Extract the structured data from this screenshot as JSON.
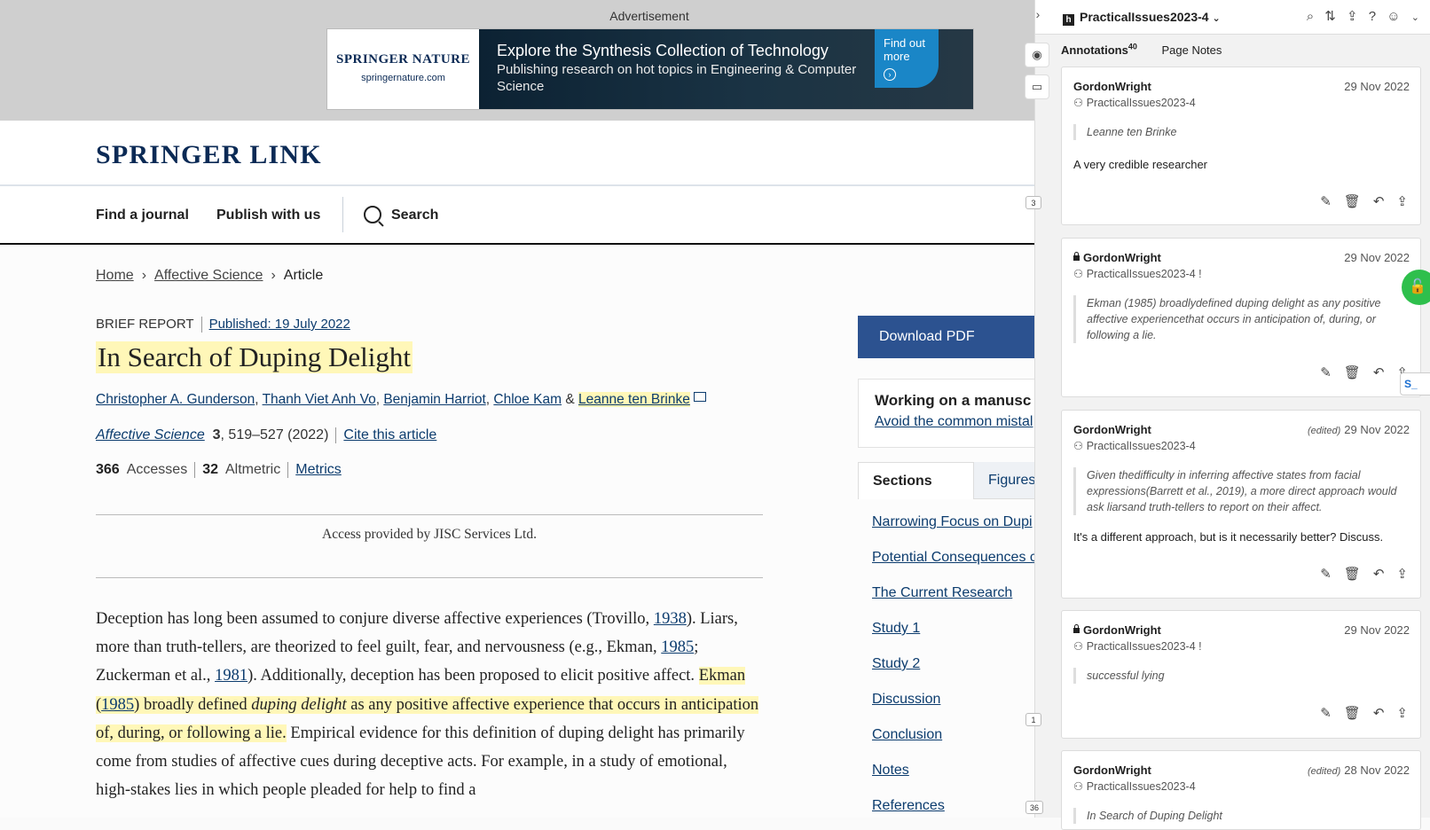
{
  "ad": {
    "label": "Advertisement",
    "brand": "SPRINGER NATURE",
    "url": "springernature.com",
    "title": "Explore the Synthesis Collection of Technology",
    "subtitle": "Publishing research on hot topics in Engineering & Computer Science",
    "cta": "Find out more"
  },
  "header": {
    "logo": "SPRINGER LINK"
  },
  "nav": {
    "find_journal": "Find a journal",
    "publish": "Publish with us",
    "search": "Search"
  },
  "breadcrumb": {
    "home": "Home",
    "journal": "Affective Science",
    "current": "Article"
  },
  "article": {
    "type": "BRIEF REPORT",
    "published": "Published: 19 July 2022",
    "title": "In Search of Duping Delight",
    "authors": [
      "Christopher A. Gunderson",
      "Thanh Viet Anh Vo",
      "Benjamin Harriot",
      "Chloe Kam"
    ],
    "author_last": "Leanne ten Brinke",
    "journal": "Affective Science",
    "volume": "3",
    "pages": ", 519–527 (2022)",
    "cite": "Cite this article",
    "accesses_count": "366",
    "accesses_label": "Accesses",
    "altmetric_count": "32",
    "altmetric_label": "Altmetric",
    "metrics": "Metrics",
    "access_note": "Access provided by JISC Services Ltd."
  },
  "body": {
    "p1a": "Deception has long been assumed to conjure diverse affective experiences (Trovillo, ",
    "ref1938": "1938",
    "p1b": "). Liars, more than truth-tellers, are theorized to feel guilt, fear, and nervousness (e.g., Ekman, ",
    "ref1985a": "1985",
    "p1c": "; Zuckerman et al., ",
    "ref1981": "1981",
    "p1d": "). Additionally, deception has been proposed to elicit positive affect. ",
    "hl1": "Ekman (",
    "ref1985b": "1985",
    "hl2": ") broadly defined ",
    "hl_em": "duping delight",
    "hl3": " as any positive affective experience that occurs in anticipation of, during, or following a lie.",
    "p1e": " Empirical evidence for this definition of duping delight has primarily come from studies of affective cues during deceptive acts. For example, in a study of emotional, high-stakes lies in which people pleaded for help to find a"
  },
  "side": {
    "download": "Download PDF",
    "manuscript_title": "Working on a manusc",
    "manuscript_link": "Avoid the common mistal",
    "tab_sections": "Sections",
    "tab_figures": "Figures",
    "sections": [
      "Narrowing Focus on Dupi",
      "Potential Consequences c",
      "The Current Research",
      "Study 1",
      "Study 2",
      "Discussion",
      "Conclusion",
      "Notes",
      "References"
    ]
  },
  "buckets": {
    "b1": "3",
    "b2": "1",
    "b3": "36"
  },
  "sidebar": {
    "group": "PracticalIssues2023-4",
    "tab_annotations": "Annotations",
    "annotation_count": "40",
    "tab_page_notes": "Page Notes",
    "tab_s": "S_",
    "cards": [
      {
        "user": "GordonWright",
        "date": "29 Nov 2022",
        "edited": "",
        "group": "PracticalIssues2023-4",
        "quote": "Leanne ten Brinke",
        "text": "A very credible researcher"
      },
      {
        "user": "GordonWright",
        "date": "29 Nov 2022",
        "edited": "",
        "group": "PracticalIssues2023-4",
        "quote": "Ekman (1985) broadlydefined duping delight as any positive affective experiencethat occurs in anticipation of, during, or following a lie.",
        "text": ""
      },
      {
        "user": "GordonWright",
        "date": "29 Nov 2022",
        "edited": "(edited)",
        "group": "PracticalIssues2023-4",
        "quote": "Given thedifficulty in inferring affective states from facial expressions(Barrett et al., 2019), a more direct approach would ask liarsand truth-tellers to report on their affect.",
        "text": "It's a different approach, but is it necessarily better? Discuss."
      },
      {
        "user": "GordonWright",
        "date": "29 Nov 2022",
        "edited": "",
        "group": "PracticalIssues2023-4",
        "quote": "successful lying",
        "text": ""
      },
      {
        "user": "GordonWright",
        "date": "28 Nov 2022",
        "edited": "(edited)",
        "group": "PracticalIssues2023-4",
        "quote": "In Search of Duping Delight",
        "text": ""
      }
    ]
  }
}
